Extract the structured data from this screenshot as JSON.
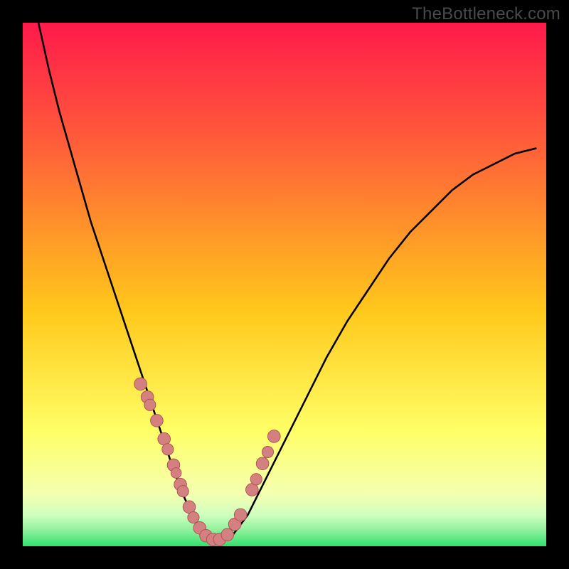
{
  "watermark": "TheBottleneck.com",
  "colors": {
    "frame": "#000000",
    "gradient_top": "#ff1a4b",
    "gradient_upper": "#ff5a3a",
    "gradient_mid": "#ffc81b",
    "gradient_low": "#ffff66",
    "gradient_lower": "#f4ffb0",
    "gradient_band1": "#cfffbe",
    "gradient_band2": "#8ff09c",
    "gradient_bottom": "#30e36e",
    "curve": "#000000",
    "dot_fill": "#d58080",
    "dot_stroke": "#a94e4e"
  },
  "chart_data": {
    "type": "line",
    "title": "",
    "xlabel": "",
    "ylabel": "",
    "xlim": [
      0,
      100
    ],
    "ylim": [
      0,
      100
    ],
    "series": [
      {
        "name": "bottleneck-curve",
        "x": [
          3,
          5,
          7,
          9,
          11,
          13,
          15,
          17,
          19,
          21,
          23,
          25,
          27,
          29,
          31,
          33,
          35,
          37,
          40,
          43,
          46,
          50,
          54,
          58,
          62,
          66,
          70,
          74,
          78,
          82,
          86,
          90,
          94,
          98
        ],
        "y": [
          100,
          91,
          83,
          76,
          69,
          62,
          56,
          50,
          44,
          38,
          32,
          26,
          20,
          14,
          9,
          5,
          2,
          1,
          2,
          6,
          12,
          20,
          28,
          36,
          43,
          49,
          55,
          60,
          64,
          68,
          71,
          73,
          75,
          76
        ]
      }
    ],
    "dots": {
      "name": "highlighted-points",
      "x": [
        22.5,
        23.8,
        24.3,
        25.6,
        27.0,
        27.7,
        28.8,
        29.3,
        30.1,
        30.6,
        31.8,
        32.6,
        33.8,
        35.0,
        36.3,
        37.6,
        39.1,
        40.5,
        41.6,
        43.8,
        44.6,
        45.8,
        46.8,
        48.0
      ],
      "y": [
        31.0,
        28.5,
        27.0,
        24.0,
        20.5,
        18.5,
        15.5,
        14.0,
        11.8,
        10.5,
        7.5,
        5.5,
        3.5,
        2.0,
        1.3,
        1.3,
        2.2,
        4.2,
        6.0,
        10.8,
        12.8,
        15.8,
        18.0,
        21.0
      ],
      "r": [
        1.2,
        1.2,
        1.1,
        1.2,
        1.2,
        1.1,
        1.2,
        1.0,
        1.2,
        1.1,
        1.2,
        1.1,
        1.2,
        1.2,
        1.2,
        1.2,
        1.2,
        1.2,
        1.2,
        1.2,
        1.1,
        1.2,
        1.1,
        1.2
      ]
    }
  }
}
